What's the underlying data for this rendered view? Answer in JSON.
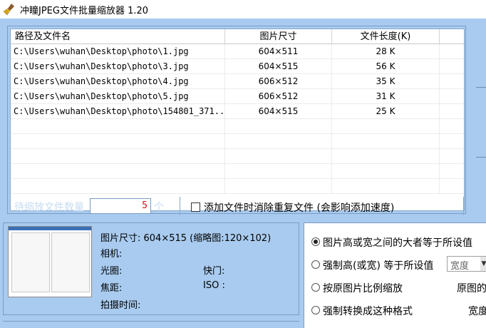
{
  "window": {
    "title": "冲瞳JPEG文件批量缩放器  1.20",
    "icon": "broom-app-icon"
  },
  "list": {
    "columns": [
      "路径及文件名",
      "图片尺寸",
      "文件长度(K)"
    ],
    "rows": [
      {
        "path": "C:\\Users\\wuhan\\Desktop\\photo\\1.jpg",
        "size": "604×511",
        "length": "28 K"
      },
      {
        "path": "C:\\Users\\wuhan\\Desktop\\photo\\3.jpg",
        "size": "604×515",
        "length": "56 K"
      },
      {
        "path": "C:\\Users\\wuhan\\Desktop\\photo\\4.jpg",
        "size": "606×512",
        "length": "35 K"
      },
      {
        "path": "C:\\Users\\wuhan\\Desktop\\photo\\5.jpg",
        "size": "606×512",
        "length": "31 K"
      },
      {
        "path": "C:\\Users\\wuhan\\Desktop\\photo\\154801_371...",
        "size": "604×515",
        "length": "25 K"
      }
    ]
  },
  "count": {
    "label": "待缩放文件数量",
    "value": "5",
    "unit": "个"
  },
  "dedupe": {
    "label": "添加文件时消除重复文件 (会影响添加速度)",
    "checked": false
  },
  "info": {
    "size": "图片尺寸: 604×515 (缩略图:120×102)",
    "camera": "相机:",
    "aperture": "光圈:",
    "shutter": "快门:",
    "focal": "焦距:",
    "iso": "ISO :",
    "time": "拍摄时间:"
  },
  "options": {
    "opt1": "图片高或宽之间的大者等于所设值",
    "opt2": "强制高(或宽) 等于所设值",
    "opt2_select": "宽度",
    "opt3": "按原图片比例缩放",
    "opt3_right": "原图的",
    "opt4": "强制转换成这种格式",
    "opt4_right": "宽度"
  },
  "colors": {
    "background": "#a9cbef",
    "count_value": "#e01010"
  }
}
